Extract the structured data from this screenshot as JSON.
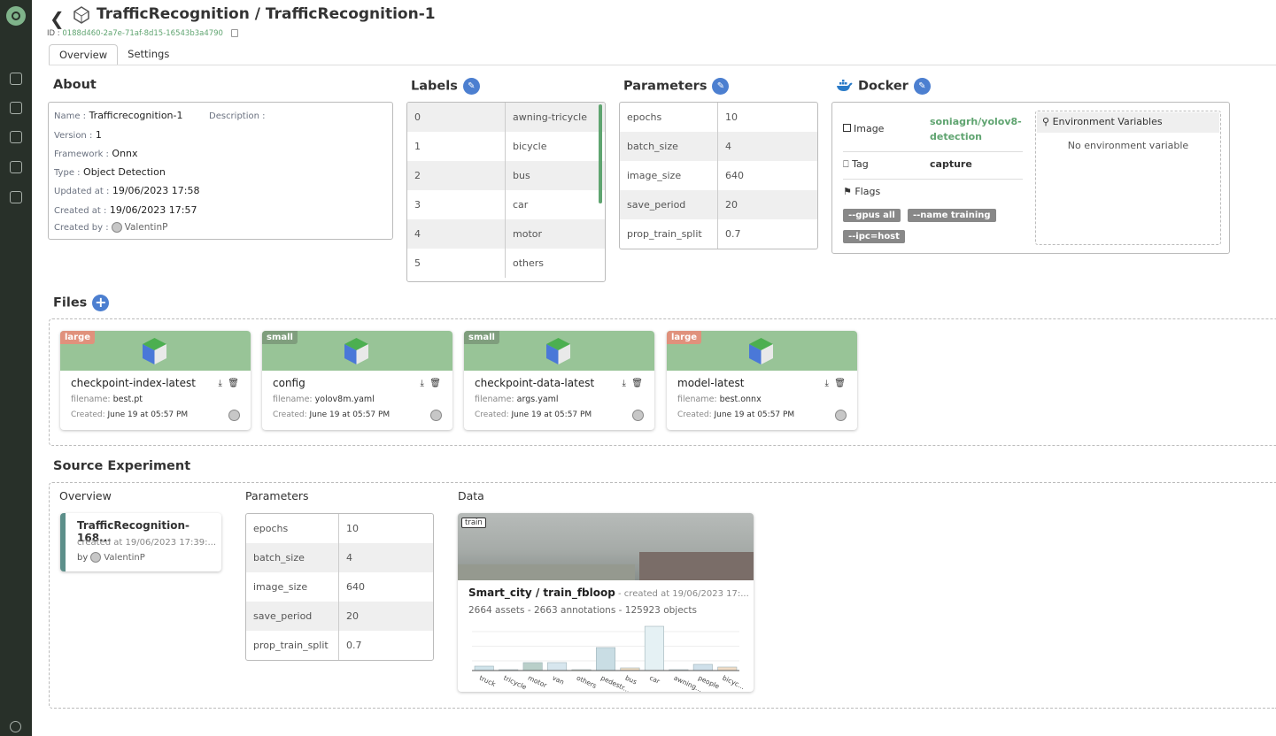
{
  "header": {
    "title": "TrafficRecognition / TrafficRecognition-1",
    "id_label": "ID :",
    "id_value": "0188d460-2a7e-71af-8d15-16543b3a4790"
  },
  "tabs": [
    "Overview",
    "Settings"
  ],
  "about": {
    "heading": "About",
    "name_k": "Name :",
    "name_v": "Trafficrecognition-1",
    "desc_k": "Description :",
    "version_k": "Version :",
    "version_v": "1",
    "framework_k": "Framework :",
    "framework_v": "Onnx",
    "type_k": "Type :",
    "type_v": "Object Detection",
    "updated_k": "Updated at :",
    "updated_v": "19/06/2023 17:58",
    "created_k": "Created at :",
    "created_v": "19/06/2023 17:57",
    "createdby_k": "Created by :",
    "createdby_v": "ValentinP"
  },
  "labels": {
    "heading": "Labels",
    "rows": [
      [
        "0",
        "awning-tricycle"
      ],
      [
        "1",
        "bicycle"
      ],
      [
        "2",
        "bus"
      ],
      [
        "3",
        "car"
      ],
      [
        "4",
        "motor"
      ],
      [
        "5",
        "others"
      ]
    ]
  },
  "parameters": {
    "heading": "Parameters",
    "rows": [
      [
        "epochs",
        "10"
      ],
      [
        "batch_size",
        "4"
      ],
      [
        "image_size",
        "640"
      ],
      [
        "save_period",
        "20"
      ],
      [
        "prop_train_split",
        "0.7"
      ]
    ]
  },
  "docker": {
    "heading": "Docker",
    "image_k": "Image",
    "image_v1": "soniagrh/yolov8-",
    "image_v2": "detection",
    "tag_k": "Tag",
    "tag_v": "capture",
    "flags_k": "Flags",
    "flags": [
      "--gpus all",
      "--name training",
      "--ipc=host"
    ],
    "env_title": "Environment Variables",
    "env_empty": "No environment variable"
  },
  "files": {
    "heading": "Files",
    "filename_k": "filename:",
    "created_k": "Created:",
    "items": [
      {
        "size": "large",
        "size_color": "#e0917c",
        "name": "checkpoint-index-latest",
        "filename": "best.pt",
        "created": "June 19 at 05:57 PM"
      },
      {
        "size": "small",
        "size_color": "#7f9e7d",
        "name": "config",
        "filename": "yolov8m.yaml",
        "created": "June 19 at 05:57 PM"
      },
      {
        "size": "small",
        "size_color": "#7f9e7d",
        "name": "checkpoint-data-latest",
        "filename": "args.yaml",
        "created": "June 19 at 05:57 PM"
      },
      {
        "size": "large",
        "size_color": "#e0917c",
        "name": "model-latest",
        "filename": "best.onnx",
        "created": "June 19 at 05:57 PM"
      }
    ]
  },
  "source": {
    "heading": "Source Experiment",
    "overview_h": "Overview",
    "params_h": "Parameters",
    "data_h": "Data",
    "exp_name": "TrafficRecognition-168...",
    "exp_created": "created at 19/06/2023 17:39:...",
    "exp_by_k": "by",
    "exp_by_v": "ValentinP",
    "params": [
      [
        "epochs",
        "10"
      ],
      [
        "batch_size",
        "4"
      ],
      [
        "image_size",
        "640"
      ],
      [
        "save_period",
        "20"
      ],
      [
        "prop_train_split",
        "0.7"
      ]
    ],
    "data_tag": "train",
    "data_name": "Smart_city / train_fbloop",
    "data_created": " - created at 19/06/2023 17:...",
    "data_stats": "2664 assets - 2663 annotations - 125923 objects"
  },
  "chart_data": {
    "type": "bar",
    "categories": [
      "truck",
      "tricycle",
      "motor",
      "van",
      "others",
      "pedestrian",
      "bus",
      "car",
      "awning-tricycle",
      "people",
      "bicycle"
    ],
    "tick_labels": [
      "truck",
      "tricycle",
      "motor",
      "van",
      "others",
      "pedestr...",
      "bus",
      "car",
      "awning...",
      "people",
      "bicyc..."
    ],
    "values": [
      5,
      1,
      9,
      9,
      0.5,
      26,
      3,
      50,
      0.5,
      7,
      4
    ],
    "colors": [
      "#cfe3ea",
      "#d9d9d9",
      "#b9cfc9",
      "#d7e6ee",
      "#f2e4c0",
      "#c9dde4",
      "#f1dfc6",
      "#e5f1f4",
      "#d9d9d9",
      "#cfe0ea",
      "#f0dcc6"
    ],
    "ylim": [
      0,
      55
    ]
  }
}
